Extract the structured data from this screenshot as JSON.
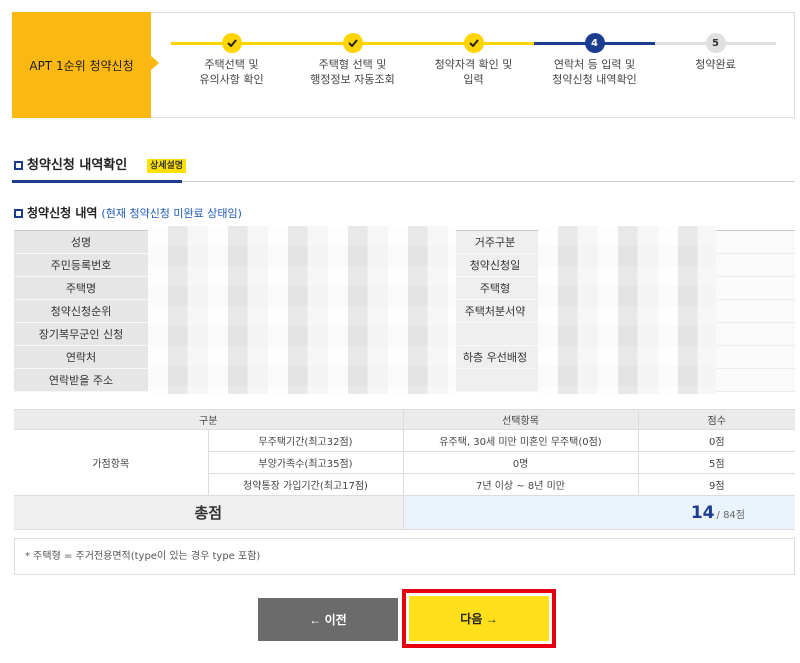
{
  "colors": {
    "brand_orange": "#fbb712",
    "step_done": "#ffd400",
    "step_current": "#1c3d8f",
    "step_upcoming": "#e0e0e0",
    "link_blue": "#1e5bb8",
    "next_button": "#ffe01b",
    "prev_button": "#6b6b6b",
    "highlight": "#e60012",
    "total_bg": "#eaf3fc"
  },
  "progress": {
    "title": "APT 1순위 청약신청",
    "current_step": 4,
    "steps": [
      {
        "icon": "check-icon",
        "label": [
          "주택선택 및",
          "유의사항 확인"
        ]
      },
      {
        "icon": "check-icon",
        "label": [
          "주택형 선택 및",
          "행정정보 자동조회"
        ]
      },
      {
        "icon": "check-icon",
        "label": [
          "청약자격 확인 및",
          "입력"
        ]
      },
      {
        "number": "4",
        "label": [
          "연락처 등 입력 및",
          "청약신청 내역확인"
        ]
      },
      {
        "number": "5",
        "label": [
          "청약완료"
        ]
      }
    ]
  },
  "section": {
    "title": "청약신청 내역확인",
    "badge": "상세설명",
    "sub_title": "청약신청 내역",
    "sub_note": "(현재 청약신청 미완료 상태임)"
  },
  "info_table": {
    "rows": [
      {
        "label": "성명",
        "right_label": "거주구분"
      },
      {
        "label": "주민등록번호",
        "right_label": "청약신청일"
      },
      {
        "label": "주택명",
        "right_label": "주택형"
      },
      {
        "label": "청약신청순위",
        "right_label": "주택처분서약"
      },
      {
        "label": "장기복무군인 신청"
      },
      {
        "label": "연락처",
        "right_label": "하층 우선배정"
      },
      {
        "label": "연락받을 주소"
      }
    ]
  },
  "score_table": {
    "headers": {
      "category": "구분",
      "selection": "선택항목",
      "score": "점수"
    },
    "group": "가점항목",
    "rows": [
      {
        "item": "무주택기간(최고32점)",
        "selection": "유주택, 30세 미만 미혼인 무주택(0점)",
        "score": "0점"
      },
      {
        "item": "부양가족수(최고35점)",
        "selection": "0명",
        "score": "5점"
      },
      {
        "item": "청약통장 가입기간(최고17점)",
        "selection": "7년 이상 ~ 8년 미만",
        "score": "9점"
      }
    ],
    "total": {
      "label": "총점",
      "value": "14",
      "max": "/ 84점"
    }
  },
  "note": "* 주택형 = 주거전용면적(type이 있는 경우 type 포함)",
  "buttons": {
    "prev": "← 이전",
    "next": "다음 →"
  }
}
